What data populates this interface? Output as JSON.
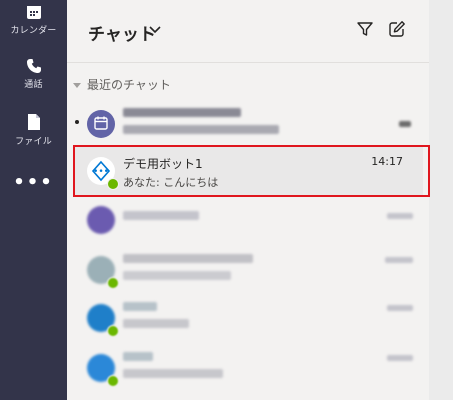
{
  "rail": {
    "items": [
      {
        "label": "カレンダー",
        "icon": "calendar-icon"
      },
      {
        "label": "通話",
        "icon": "phone-icon"
      },
      {
        "label": "ファイル",
        "icon": "file-icon"
      }
    ],
    "more": "•••"
  },
  "header": {
    "title": "チャット",
    "chevron_icon": "chevron-down-icon",
    "filter_icon": "filter-icon",
    "compose_icon": "compose-icon"
  },
  "section": {
    "label": "最近のチャット"
  },
  "selected_chat": {
    "name": "デモ用ボット1",
    "preview": "あなた: こんにちは",
    "time": "14:17",
    "avatar_icon": "bot-icon",
    "status_icon": "available-badge-icon"
  },
  "colors": {
    "rail": "#33344a",
    "accent": "#6264a7",
    "highlight_border": "#e0161e",
    "status_available": "#6bb700"
  }
}
